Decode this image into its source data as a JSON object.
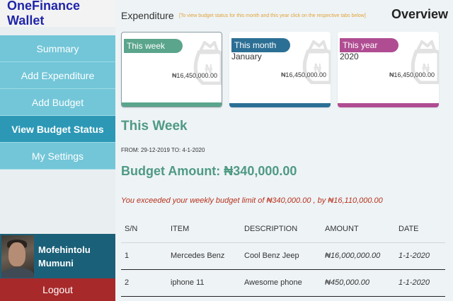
{
  "app": {
    "brand": "OneFinance Wallet"
  },
  "sidebar": {
    "items": [
      {
        "label": "Summary"
      },
      {
        "label": "Add Expenditure"
      },
      {
        "label": "Add Budget"
      },
      {
        "label": "View Budget Status",
        "active": true
      },
      {
        "label": "My Settings"
      }
    ],
    "profile": {
      "first_name": "Mofehintolu",
      "last_name": "Mumuni"
    },
    "logout_label": "Logout"
  },
  "header": {
    "title": "Expenditure",
    "hint": "[To view budget status for this month and this year click on the respective tabs below]",
    "overview": "Overview"
  },
  "cards": [
    {
      "tag": "This week",
      "sub": "",
      "amount": "₦16,450,000.00",
      "color": "#5aa58c",
      "selected": true
    },
    {
      "tag": "This month",
      "sub": "January",
      "amount": "₦16,450,000.00",
      "color": "#2c6f95"
    },
    {
      "tag": "This year",
      "sub": "2020",
      "amount": "₦16,450,000.00",
      "color": "#b04d92"
    }
  ],
  "details": {
    "title": "This Week",
    "period": "FROM: 29-12-2019 TO: 4-1-2020",
    "budget": "Budget Amount: ₦340,000.00",
    "warning": "You exceeded your weekly budget limit of ₦340,000.00 , by ₦16,110,000.00"
  },
  "table": {
    "headers": [
      "S/N",
      "ITEM",
      "DESCRIPTION",
      "AMOUNT",
      "DATE"
    ],
    "rows": [
      [
        "1",
        "Mercedes Benz",
        "Cool Benz Jeep",
        "₦16,000,000.00",
        "1-1-2020"
      ],
      [
        "2",
        "iphone 11",
        "Awesome phone",
        "₦450,000.00",
        "1-1-2020"
      ]
    ]
  },
  "colors": {
    "sidebar_item": "#72c6d8",
    "sidebar_active": "#2c98b6",
    "profile_bg": "#1b6079",
    "logout_bg": "#a8292a",
    "accent_green": "#4f9a83",
    "warning_red": "#b8331d"
  },
  "icons": {
    "card_background": "money-bag-icon"
  }
}
